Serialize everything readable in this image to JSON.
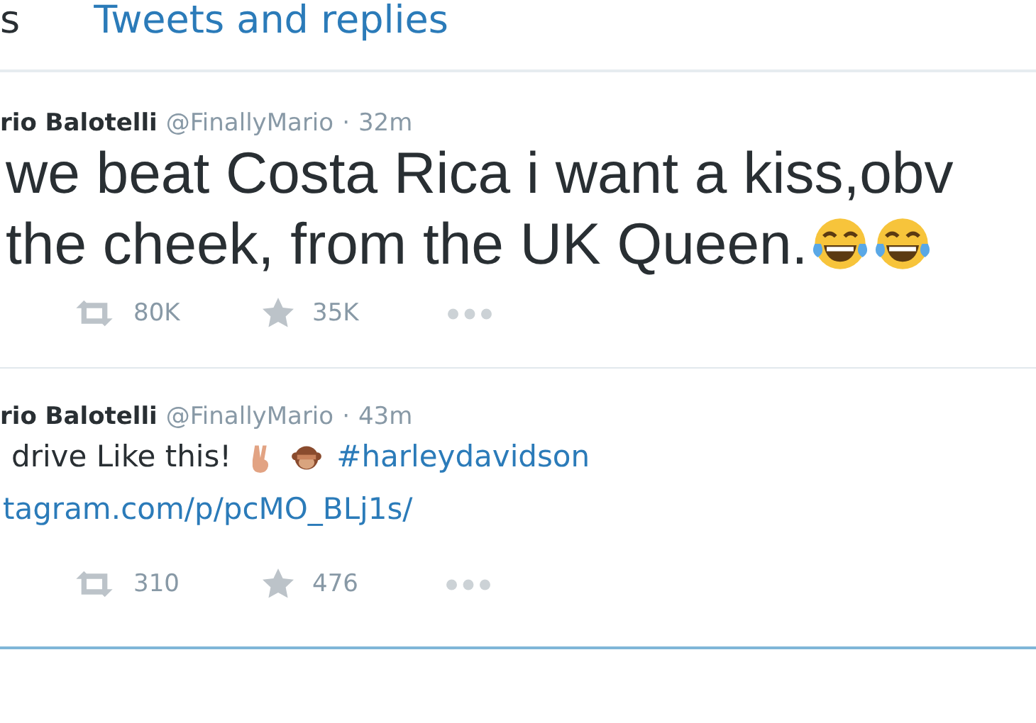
{
  "tabs": [
    {
      "label": "s",
      "selected": true
    },
    {
      "label": "Tweets and replies",
      "selected": false
    }
  ],
  "tweets": [
    {
      "name": "rio Balotelli",
      "handle": "@FinallyMario",
      "separator": "·",
      "time": "32m",
      "kind": "large",
      "lines": [
        [
          {
            "kind": "text",
            "text": "we beat Costa Rica i want a kiss,obv"
          }
        ],
        [
          {
            "kind": "text",
            "text": "the cheek, from the UK Queen."
          },
          {
            "kind": "laugh"
          },
          {
            "kind": "laugh"
          }
        ]
      ],
      "retweets": "80K",
      "favorites": "35K"
    },
    {
      "name": "rio Balotelli",
      "handle": "@FinallyMario",
      "separator": "·",
      "time": "43m",
      "kind": "normal",
      "lines": [
        [
          {
            "kind": "text",
            "text": "drive Like this!"
          },
          {
            "kind": "peace"
          },
          {
            "kind": "monkey"
          },
          {
            "kind": "hashtag",
            "text": "#harleydavidson"
          }
        ],
        [
          {
            "kind": "link",
            "text": "tagram.com/p/pcMO_BLj1s/"
          }
        ]
      ],
      "retweets": "310",
      "favorites": "476"
    }
  ]
}
